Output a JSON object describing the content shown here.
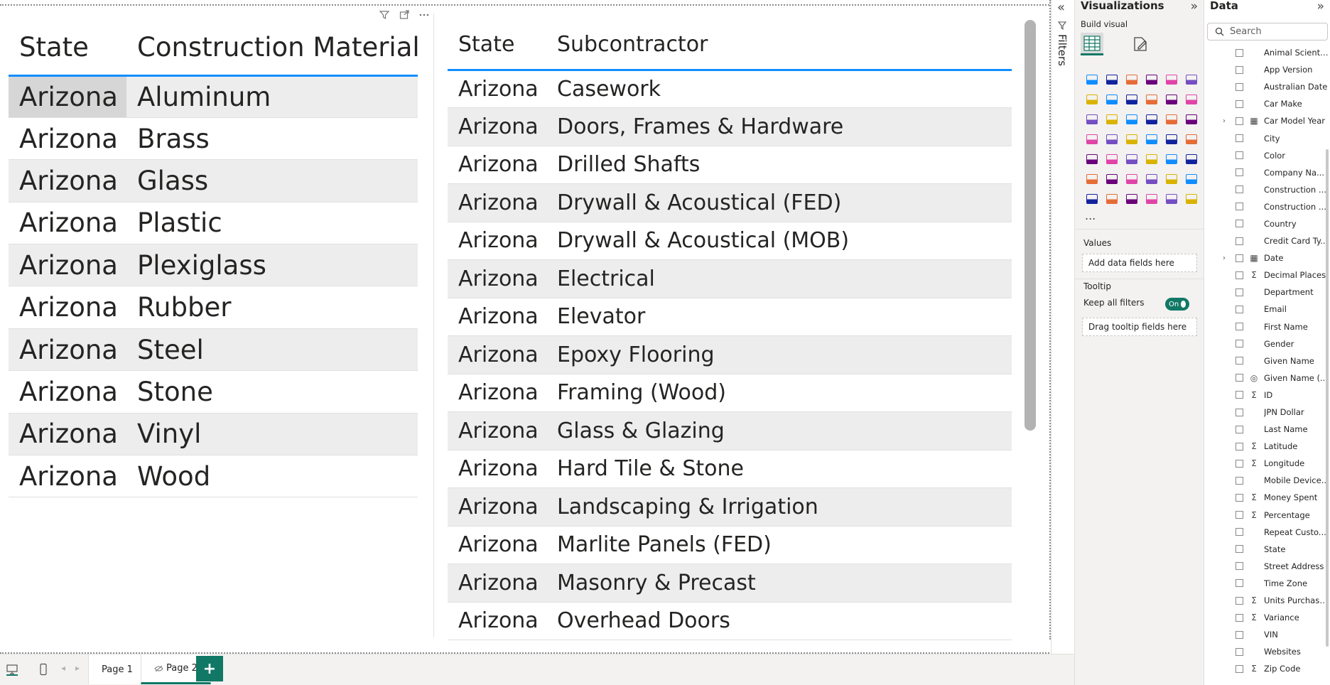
{
  "table1": {
    "headers": [
      "State",
      "Construction Material"
    ],
    "rows": [
      [
        "Arizona",
        "Aluminum"
      ],
      [
        "Arizona",
        "Brass"
      ],
      [
        "Arizona",
        "Glass"
      ],
      [
        "Arizona",
        "Plastic"
      ],
      [
        "Arizona",
        "Plexiglass"
      ],
      [
        "Arizona",
        "Rubber"
      ],
      [
        "Arizona",
        "Steel"
      ],
      [
        "Arizona",
        "Stone"
      ],
      [
        "Arizona",
        "Vinyl"
      ],
      [
        "Arizona",
        "Wood"
      ]
    ]
  },
  "table2": {
    "headers": [
      "State",
      "Subcontractor"
    ],
    "rows": [
      [
        "Arizona",
        "Casework"
      ],
      [
        "Arizona",
        "Doors, Frames & Hardware"
      ],
      [
        "Arizona",
        "Drilled Shafts"
      ],
      [
        "Arizona",
        "Drywall & Acoustical (FED)"
      ],
      [
        "Arizona",
        "Drywall & Acoustical (MOB)"
      ],
      [
        "Arizona",
        "Electrical"
      ],
      [
        "Arizona",
        "Elevator"
      ],
      [
        "Arizona",
        "Epoxy Flooring"
      ],
      [
        "Arizona",
        "Framing (Wood)"
      ],
      [
        "Arizona",
        "Glass & Glazing"
      ],
      [
        "Arizona",
        "Hard Tile & Stone"
      ],
      [
        "Arizona",
        "Landscaping & Irrigation"
      ],
      [
        "Arizona",
        "Marlite Panels (FED)"
      ],
      [
        "Arizona",
        "Masonry & Precast"
      ],
      [
        "Arizona",
        "Overhead Doors"
      ]
    ]
  },
  "pages": {
    "tabs": [
      "Page 1",
      "Page 2"
    ],
    "active": "Page 2",
    "add_label": "+"
  },
  "filters": {
    "label": "Filters"
  },
  "visualizations": {
    "title": "Visualizations",
    "build_label": "Build visual",
    "more": "...",
    "values_label": "Values",
    "values_placeholder": "Add data fields here",
    "tooltip_label": "Tooltip",
    "keep_filters_label": "Keep all filters",
    "toggle_label": "On",
    "tooltip_placeholder": "Drag tooltip fields here"
  },
  "data_pane": {
    "title": "Data",
    "search_placeholder": "Search",
    "fields": [
      {
        "name": "Animal Scienti...",
        "kind": "",
        "expand": false
      },
      {
        "name": "App Version",
        "kind": "",
        "expand": false
      },
      {
        "name": "Australian Date",
        "kind": "",
        "expand": false
      },
      {
        "name": "Car Make",
        "kind": "",
        "expand": false
      },
      {
        "name": "Car Model Year",
        "kind": "calendar",
        "expand": true
      },
      {
        "name": "City",
        "kind": "",
        "expand": false
      },
      {
        "name": "Color",
        "kind": "",
        "expand": false
      },
      {
        "name": "Company Na...",
        "kind": "",
        "expand": false
      },
      {
        "name": "Construction ...",
        "kind": "",
        "expand": false
      },
      {
        "name": "Construction ...",
        "kind": "",
        "expand": false
      },
      {
        "name": "Country",
        "kind": "",
        "expand": false
      },
      {
        "name": "Credit Card Ty...",
        "kind": "",
        "expand": false
      },
      {
        "name": "Date",
        "kind": "calendar",
        "expand": true
      },
      {
        "name": "Decimal Places",
        "kind": "sigma",
        "expand": false
      },
      {
        "name": "Department",
        "kind": "",
        "expand": false
      },
      {
        "name": "Email",
        "kind": "",
        "expand": false
      },
      {
        "name": "First Name",
        "kind": "",
        "expand": false
      },
      {
        "name": "Gender",
        "kind": "",
        "expand": false
      },
      {
        "name": "Given Name",
        "kind": "",
        "expand": false
      },
      {
        "name": "Given Name (...",
        "kind": "group",
        "expand": false
      },
      {
        "name": "ID",
        "kind": "sigma",
        "expand": false
      },
      {
        "name": "JPN Dollar",
        "kind": "",
        "expand": false
      },
      {
        "name": "Last Name",
        "kind": "",
        "expand": false
      },
      {
        "name": "Latitude",
        "kind": "sigma",
        "expand": false
      },
      {
        "name": "Longitude",
        "kind": "sigma",
        "expand": false
      },
      {
        "name": "Mobile Device...",
        "kind": "",
        "expand": false
      },
      {
        "name": "Money Spent",
        "kind": "sigma",
        "expand": false
      },
      {
        "name": "Percentage",
        "kind": "sigma",
        "expand": false
      },
      {
        "name": "Repeat Custo...",
        "kind": "",
        "expand": false
      },
      {
        "name": "State",
        "kind": "",
        "expand": false
      },
      {
        "name": "Street Address",
        "kind": "",
        "expand": false
      },
      {
        "name": "Time Zone",
        "kind": "",
        "expand": false
      },
      {
        "name": "Units Purchased",
        "kind": "sigma",
        "expand": false
      },
      {
        "name": "Variance",
        "kind": "sigma",
        "expand": false
      },
      {
        "name": "VIN",
        "kind": "",
        "expand": false
      },
      {
        "name": "Websites",
        "kind": "",
        "expand": false
      },
      {
        "name": "Zip Code",
        "kind": "sigma",
        "expand": false
      }
    ]
  },
  "viz_icons": [
    "stacked-bar-chart",
    "stacked-column-chart",
    "clustered-bar-chart",
    "clustered-column-chart",
    "100-stacked-bar-chart",
    "100-stacked-column-chart",
    "line-chart",
    "area-chart",
    "stacked-area-chart",
    "ribbon-chart",
    "line-clustered-column-chart",
    "line-stacked-column-chart",
    "waterfall-chart",
    "scatter-chart-alt",
    "funnel-chart",
    "scatter-chart",
    "pie-chart",
    "donut-chart",
    "treemap",
    "map",
    "filled-map",
    "azure-map",
    "gauge",
    "card",
    "multi-row-card",
    "kpi",
    "slicer",
    "table",
    "matrix",
    "r-visual",
    "python-visual",
    "key-influencers",
    "decomposition-tree",
    "qa-visual",
    "smart-narrative",
    "metrics-visual",
    "paginated-report",
    "power-apps",
    "power-automate",
    "custom-visual-1",
    "custom-visual-2",
    "custom-visual-3"
  ],
  "colors": {
    "accent": "#117865",
    "header_underline": "#118dff",
    "row_alt": "#ededed"
  }
}
